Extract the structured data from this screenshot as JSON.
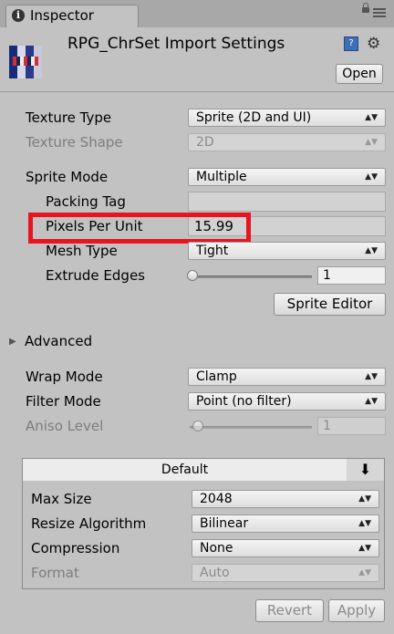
{
  "window": {
    "tab_label": "Inspector",
    "tab_icon": "info-icon",
    "lock_icon": "lock-icon",
    "menu_icon": "menu-icon"
  },
  "header": {
    "title": "RPG_ChrSet Import Settings",
    "open_label": "Open",
    "help_icon": "help-icon",
    "gear_icon": "gear-icon"
  },
  "settings": {
    "texture_type": {
      "label": "Texture Type",
      "value": "Sprite (2D and UI)"
    },
    "texture_shape": {
      "label": "Texture Shape",
      "value": "2D"
    },
    "sprite_mode": {
      "label": "Sprite Mode",
      "value": "Multiple"
    },
    "packing_tag": {
      "label": "Packing Tag",
      "value": ""
    },
    "pixels_per_unit": {
      "label": "Pixels Per Unit",
      "value": "15.99"
    },
    "mesh_type": {
      "label": "Mesh Type",
      "value": "Tight"
    },
    "extrude_edges": {
      "label": "Extrude Edges",
      "value": "1"
    },
    "sprite_editor_label": "Sprite Editor",
    "advanced_label": "Advanced",
    "wrap_mode": {
      "label": "Wrap Mode",
      "value": "Clamp"
    },
    "filter_mode": {
      "label": "Filter Mode",
      "value": "Point (no filter)"
    },
    "aniso_level": {
      "label": "Aniso Level",
      "value": "1"
    }
  },
  "platform": {
    "tab_label": "Default",
    "download_icon": "download-icon",
    "max_size": {
      "label": "Max Size",
      "value": "2048"
    },
    "resize_algorithm": {
      "label": "Resize Algorithm",
      "value": "Bilinear"
    },
    "compression": {
      "label": "Compression",
      "value": "None"
    },
    "format": {
      "label": "Format",
      "value": "Auto"
    }
  },
  "actions": {
    "revert_label": "Revert",
    "apply_label": "Apply"
  },
  "colors": {
    "highlight": "#e8141f",
    "background": "#c2c2c2"
  }
}
